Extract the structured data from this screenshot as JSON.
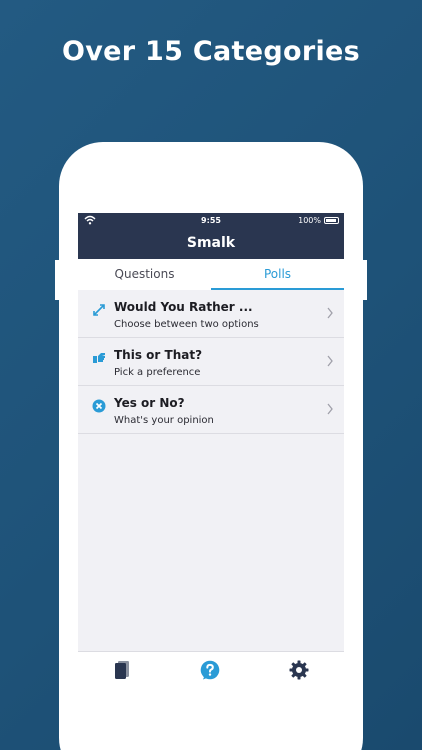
{
  "headline": "Over 15 Categories",
  "status_bar": {
    "time": "9:55",
    "battery": "100%"
  },
  "app_title": "Smalk",
  "tabs": [
    {
      "label": "Questions",
      "active": false
    },
    {
      "label": "Polls",
      "active": true
    }
  ],
  "rows": [
    {
      "title": "Would You Rather ...",
      "subtitle": "Choose between two options",
      "icon": "expand-arrows-icon"
    },
    {
      "title": "This or That?",
      "subtitle": "Pick a preference",
      "icon": "pointing-hand-icon"
    },
    {
      "title": "Yes or No?",
      "subtitle": "What's your opinion",
      "icon": "x-circle-icon"
    }
  ],
  "tab_bar": {
    "items": [
      "cards-icon",
      "question-bubble-icon",
      "gear-icon"
    ],
    "selected": "question-bubble-icon"
  },
  "colors": {
    "background": "#1e5278",
    "navbar": "#2a3650",
    "accent": "#2a9bd6",
    "list_background": "#f1f1f5"
  }
}
